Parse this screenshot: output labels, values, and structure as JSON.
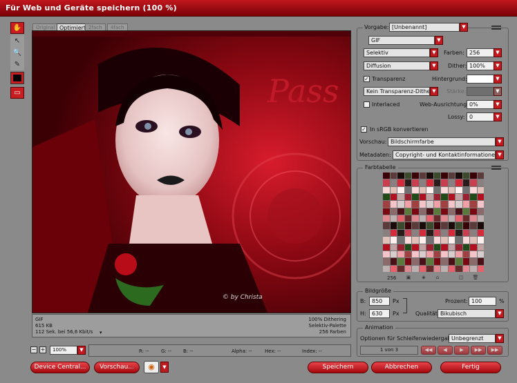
{
  "window": {
    "title": "Für Web und Geräte speichern (100 %)"
  },
  "tabs": [
    "Original",
    "Optimiert",
    "2fach",
    "4fach"
  ],
  "tabs_selected": "Optimiert",
  "preview": {
    "format": "GIF",
    "filesize": "615 KB",
    "download_time": "112 Sek. bei 56,6 Kbit/s",
    "dither": "100% Dithering",
    "palette": "Selektiv-Palette",
    "colors": "256 Farben",
    "artwork_text": "Pass",
    "watermark": "© by Christa"
  },
  "zoom": {
    "value": "100%",
    "minus": "−",
    "plus": "+"
  },
  "readout": {
    "r": "R: --",
    "g": "G: --",
    "b": "B: --",
    "alpha": "Alpha: --",
    "hex": "Hex: --",
    "index": "Index: --"
  },
  "settings": {
    "preset_label": "Vorgabe:",
    "preset_value": "[Unbenannt]",
    "format": "GIF",
    "reduction": "Selektiv",
    "colors_label": "Farben:",
    "colors_value": "256",
    "dither_algo": "Diffusion",
    "dither_label": "Dither:",
    "dither_value": "100%",
    "transparency_label": "Transparenz",
    "transparency_checked": "✓",
    "matte_label": "Hintergrund:",
    "trans_dither": "Kein Transparenz-Dither",
    "amount_label": "Stärke:",
    "interlaced_label": "Interlaced",
    "websnap_label": "Web-Ausrichtung:",
    "websnap_value": "0%",
    "lossy_label": "Lossy:",
    "lossy_value": "0",
    "srgb_label": "In sRGB konvertieren",
    "srgb_checked": "✓",
    "preview_label": "Vorschau:",
    "preview_value": "Bildschirmfarbe",
    "metadata_label": "Metadaten:",
    "metadata_value": "Copyright- und Kontaktinformationen"
  },
  "color_table": {
    "title": "Farbtabelle",
    "count": "256"
  },
  "image_size": {
    "title": "Bildgröße",
    "w_label": "B:",
    "w_value": "850",
    "h_label": "H:",
    "h_value": "630",
    "unit": "Px",
    "percent_label": "Prozent:",
    "percent_value": "100",
    "percent_unit": "%",
    "quality_label": "Qualität:",
    "quality_value": "Bikubisch"
  },
  "animation": {
    "title": "Animation",
    "loop_label": "Optionen für Schleifenwiedergabe:",
    "loop_value": "Unbegrenzt",
    "frame": "1 von 3"
  },
  "buttons": {
    "device_central": "Device Central...",
    "preview": "Vorschau...",
    "save": "Speichern",
    "cancel": "Abbrechen",
    "done": "Fertig"
  },
  "colors": {
    "accent": "#c01a20",
    "titlebar": "#9e0d12",
    "panel": "#8a8a8a"
  }
}
